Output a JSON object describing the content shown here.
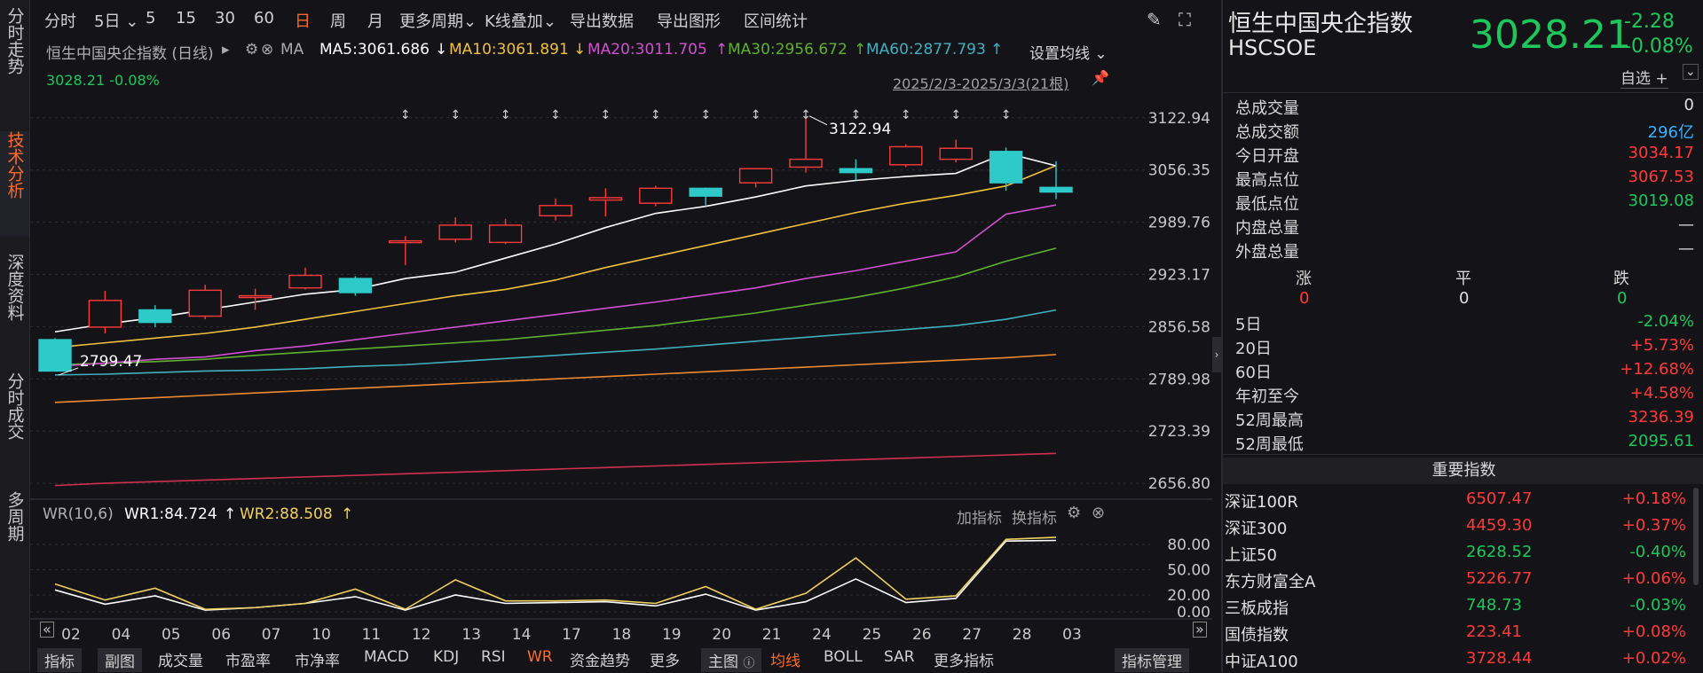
{
  "left_tabs": [
    "分时走势",
    "技术分析",
    "深度资料",
    "分时成交",
    "多周期"
  ],
  "toolbar": {
    "items": [
      "分时",
      "5日",
      "5",
      "15",
      "30",
      "60",
      "日",
      "周",
      "月",
      "更多周期",
      "K线叠加",
      "导出数据",
      "导出图形",
      "区间统计"
    ],
    "active": "日"
  },
  "header": {
    "index_name": "恒生中国央企指数 (日线)",
    "ma_label": "MA",
    "ma5": "MA5:3061.686",
    "ma10": "MA10:3061.891",
    "ma20": "MA20:3011.705",
    "ma30": "MA30:2956.672",
    "ma60": "MA60:2877.793",
    "set_ma": "设置均线",
    "current": "3028.21 -0.08%",
    "range": "2025/2/3-2025/3/3(21根)"
  },
  "colors": {
    "up": "#ff3a3a",
    "down": "#2ec9c9",
    "ma5": "#ffffff",
    "ma10": "#f0c040",
    "ma20": "#d050d0",
    "ma30": "#60b030",
    "ma60": "#40b0c0",
    "ma120": "#f08a30",
    "ma250": "#d03050",
    "wr1": "#ffffff",
    "wr2": "#f0d060"
  },
  "chart_data": [
    {
      "type": "candlestick",
      "title": "恒生中国央企指数 (日线)",
      "x": [
        "02",
        "04",
        "05",
        "06",
        "07",
        "10",
        "11",
        "12",
        "13",
        "14",
        "17",
        "18",
        "19",
        "20",
        "21",
        "24",
        "25",
        "26",
        "27",
        "28",
        "03"
      ],
      "ohlc": [
        [
          2840,
          2800,
          2842,
          2799.47
        ],
        [
          2856,
          2890,
          2902,
          2848
        ],
        [
          2878,
          2862,
          2884,
          2856
        ],
        [
          2870,
          2903,
          2910,
          2866
        ],
        [
          2895,
          2896,
          2905,
          2878
        ],
        [
          2906,
          2922,
          2932,
          2904
        ],
        [
          2918,
          2900,
          2921,
          2896
        ],
        [
          2965,
          2966,
          2972,
          2935
        ],
        [
          2968,
          2986,
          2996,
          2964
        ],
        [
          2964,
          2986,
          2994,
          2962
        ],
        [
          2998,
          3011,
          3020,
          2992
        ],
        [
          3018,
          3021,
          3033,
          2997
        ],
        [
          3014,
          3033,
          3036,
          3010
        ],
        [
          3033,
          3023,
          3034,
          3010
        ],
        [
          3040,
          3058,
          3058,
          3034
        ],
        [
          3060,
          3070,
          3122.94,
          3053
        ],
        [
          3058,
          3053,
          3070,
          3044
        ],
        [
          3063,
          3086,
          3089,
          3060
        ],
        [
          3070,
          3084,
          3095,
          3066
        ],
        [
          3080,
          3040,
          3085,
          3030
        ],
        [
          3034.17,
          3028.21,
          3067.53,
          3019.08
        ]
      ],
      "ma5": [
        2850,
        2860,
        2868,
        2878,
        2888,
        2898,
        2904,
        2918,
        2926,
        2944,
        2962,
        2983,
        3001,
        3010,
        3022,
        3036,
        3043,
        3048,
        3052,
        3078,
        3061.686
      ],
      "ma10": [
        2830,
        2836,
        2842,
        2848,
        2856,
        2866,
        2876,
        2886,
        2896,
        2904,
        2916,
        2932,
        2946,
        2960,
        2974,
        2988,
        3002,
        3014,
        3024,
        3036,
        3061.891
      ],
      "ma20": [
        2806,
        2810,
        2815,
        2818,
        2826,
        2832,
        2840,
        2848,
        2856,
        2864,
        2872,
        2880,
        2888,
        2897,
        2906,
        2918,
        2928,
        2940,
        2952,
        3000,
        3011.705
      ],
      "ma30": [
        2808,
        2810,
        2812,
        2815,
        2820,
        2824,
        2828,
        2832,
        2836,
        2840,
        2846,
        2852,
        2858,
        2866,
        2874,
        2884,
        2894,
        2906,
        2920,
        2940,
        2956.672
      ],
      "ma60": [
        2795,
        2796,
        2798,
        2800,
        2801,
        2803,
        2806,
        2808,
        2812,
        2816,
        2820,
        2824,
        2828,
        2833,
        2838,
        2843,
        2848,
        2853,
        2858,
        2866,
        2877.793
      ],
      "ma120": [
        2760,
        2763,
        2766,
        2769,
        2772,
        2775,
        2778,
        2781,
        2784,
        2787,
        2790,
        2793,
        2796,
        2799,
        2802,
        2805,
        2808,
        2811,
        2814,
        2817,
        2821
      ],
      "ma250": [
        2654,
        2657,
        2659,
        2661,
        2663,
        2665,
        2667,
        2669,
        2671,
        2673,
        2675,
        2677,
        2679,
        2681,
        2683,
        2685,
        2687,
        2689,
        2691,
        2693,
        2695
      ],
      "y_ticks": [
        "3122.94",
        "3056.35",
        "2989.76",
        "2923.17",
        "2856.58",
        "2789.98",
        "2723.39",
        "2656.80"
      ],
      "ylim": [
        2640,
        3160
      ],
      "annotations": {
        "high": "3122.94",
        "low": "2799.47"
      },
      "grid": true
    },
    {
      "type": "line",
      "title": "WR(10,6)",
      "series": [
        {
          "name": "WR1",
          "values": [
            26,
            9,
            19,
            2,
            5,
            10,
            18,
            2,
            20,
            10,
            11,
            12,
            7,
            21,
            2,
            12,
            39,
            11,
            16,
            84,
            84.724
          ]
        },
        {
          "name": "WR2",
          "values": [
            33,
            14,
            28,
            3,
            5,
            10,
            27,
            3,
            38,
            13,
            13,
            14,
            10,
            30,
            3,
            22,
            64,
            15,
            19,
            86,
            88.508
          ]
        }
      ],
      "y_ticks": [
        "80.00",
        "50.00",
        "20.00",
        "0.00"
      ],
      "ylim": [
        0,
        100
      ]
    }
  ],
  "wr_header": {
    "label": "WR(10,6)",
    "wr1": "WR1:84.724",
    "wr2": "WR2:88.508",
    "add": "加指标",
    "swap": "换指标"
  },
  "bottom_toolbar": {
    "left": [
      "指标",
      "副图",
      "成交量",
      "市盈率",
      "市净率",
      "MACD",
      "KDJ",
      "RSI",
      "WR",
      "资金趋势",
      "更多"
    ],
    "main": "主图",
    "main_items": [
      "均线",
      "BOLL",
      "SAR",
      "更多指标"
    ],
    "manage": "指标管理",
    "selected_left": "WR",
    "selected_main": "均线"
  },
  "quote": {
    "name": "恒生中国央企指数",
    "code": "HSCSOE",
    "price": "3028.21",
    "change": "-2.28",
    "change_pct": "-0.08%",
    "watch": "自选 +",
    "stats": [
      {
        "k": "总成交量",
        "v": "0",
        "c": "white"
      },
      {
        "k": "总成交额",
        "v": "296亿",
        "c": "blue"
      },
      {
        "k": "今日开盘",
        "v": "3034.17",
        "c": "red"
      },
      {
        "k": "最高点位",
        "v": "3067.53",
        "c": "red"
      },
      {
        "k": "最低点位",
        "v": "3019.08",
        "c": "green"
      },
      {
        "k": "内盘总量",
        "v": "—",
        "c": "white"
      },
      {
        "k": "外盘总量",
        "v": "—",
        "c": "white"
      }
    ],
    "breadth": {
      "up_label": "涨",
      "flat_label": "平",
      "down_label": "跌",
      "up": "0",
      "flat": "0",
      "down": "0"
    },
    "perf": [
      {
        "k": "5日",
        "v": "-2.04%",
        "c": "green"
      },
      {
        "k": "20日",
        "v": "+5.73%",
        "c": "red"
      },
      {
        "k": "60日",
        "v": "+12.68%",
        "c": "red"
      },
      {
        "k": "年初至今",
        "v": "+4.58%",
        "c": "red"
      },
      {
        "k": "52周最高",
        "v": "3236.39",
        "c": "red"
      },
      {
        "k": "52周最低",
        "v": "2095.61",
        "c": "green"
      }
    ]
  },
  "indices": {
    "title": "重要指数",
    "rows": [
      {
        "name": "深证100R",
        "value": "6507.47",
        "pct": "+0.18%",
        "c": "red"
      },
      {
        "name": "深证300",
        "value": "4459.30",
        "pct": "+0.37%",
        "c": "red"
      },
      {
        "name": "上证50",
        "value": "2628.52",
        "pct": "-0.40%",
        "c": "green"
      },
      {
        "name": "东方财富全A",
        "value": "5226.77",
        "pct": "+0.06%",
        "c": "red"
      },
      {
        "name": "三板成指",
        "value": "748.73",
        "pct": "-0.03%",
        "c": "green"
      },
      {
        "name": "国债指数",
        "value": "223.41",
        "pct": "+0.08%",
        "c": "red"
      },
      {
        "name": "中证A100",
        "value": "3728.44",
        "pct": "+0.02%",
        "c": "red"
      }
    ]
  }
}
